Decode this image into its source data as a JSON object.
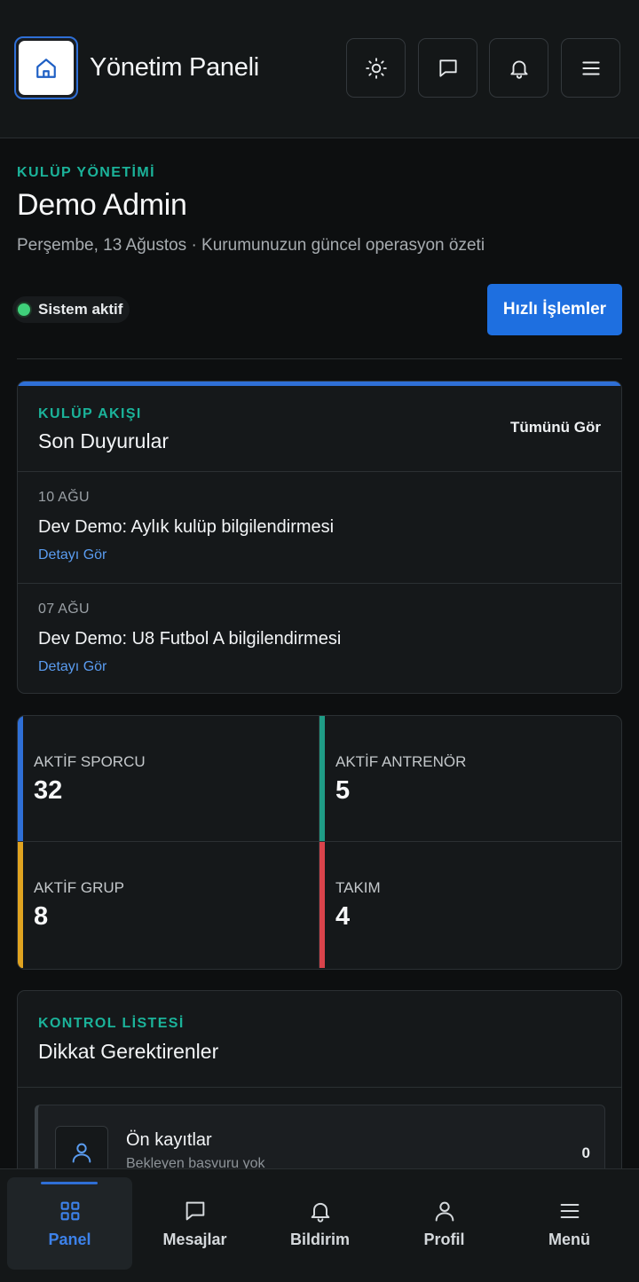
{
  "header": {
    "title": "Yönetim Paneli",
    "icons": [
      "home-icon",
      "sun-icon",
      "message-icon",
      "bell-icon",
      "menu-icon"
    ]
  },
  "intro": {
    "eyebrow": "KULÜP YÖNETİMİ",
    "title": "Demo Admin",
    "subtitle": "Perşembe, 13 Ağustos · Kurumunuzun güncel operasyon özeti",
    "status": "Sistem aktif",
    "quick_actions": "Hızlı İşlemler"
  },
  "announcements": {
    "eyebrow": "KULÜP AKIŞI",
    "title": "Son Duyurular",
    "see_all": "Tümünü Gör",
    "items": [
      {
        "date": "10 AĞU",
        "text": "Dev Demo: Aylık kulüp bilgilendirmesi",
        "link": "Detayı Gör"
      },
      {
        "date": "07 AĞU",
        "text": "Dev Demo: U8 Futbol A bilgilendirmesi",
        "link": "Detayı Gör"
      }
    ]
  },
  "stats": [
    {
      "label": "AKTİF SPORCU",
      "value": "32",
      "color": "#2f6fd6"
    },
    {
      "label": "AKTİF ANTRENÖR",
      "value": "5",
      "color": "#1f9c86"
    },
    {
      "label": "AKTİF GRUP",
      "value": "8",
      "color": "#e0a320"
    },
    {
      "label": "TAKIM",
      "value": "4",
      "color": "#d9434b"
    }
  ],
  "checklist": {
    "eyebrow": "KONTROL LİSTESİ",
    "title": "Dikkat Gerektirenler",
    "items": [
      {
        "name": "Ön kayıtlar",
        "desc": "Bekleyen başvuru yok",
        "count": "0"
      }
    ]
  },
  "nav": [
    {
      "label": "Panel",
      "icon": "grid-icon",
      "active": true
    },
    {
      "label": "Mesajlar",
      "icon": "message-icon",
      "active": false
    },
    {
      "label": "Bildirim",
      "icon": "bell-icon",
      "active": false
    },
    {
      "label": "Profil",
      "icon": "user-icon",
      "active": false
    },
    {
      "label": "Menü",
      "icon": "menu-icon",
      "active": false
    }
  ],
  "colors": {
    "accent": "#2f6fd6",
    "eyebrow": "#1bb39a",
    "status_ok": "#3fd07a"
  }
}
